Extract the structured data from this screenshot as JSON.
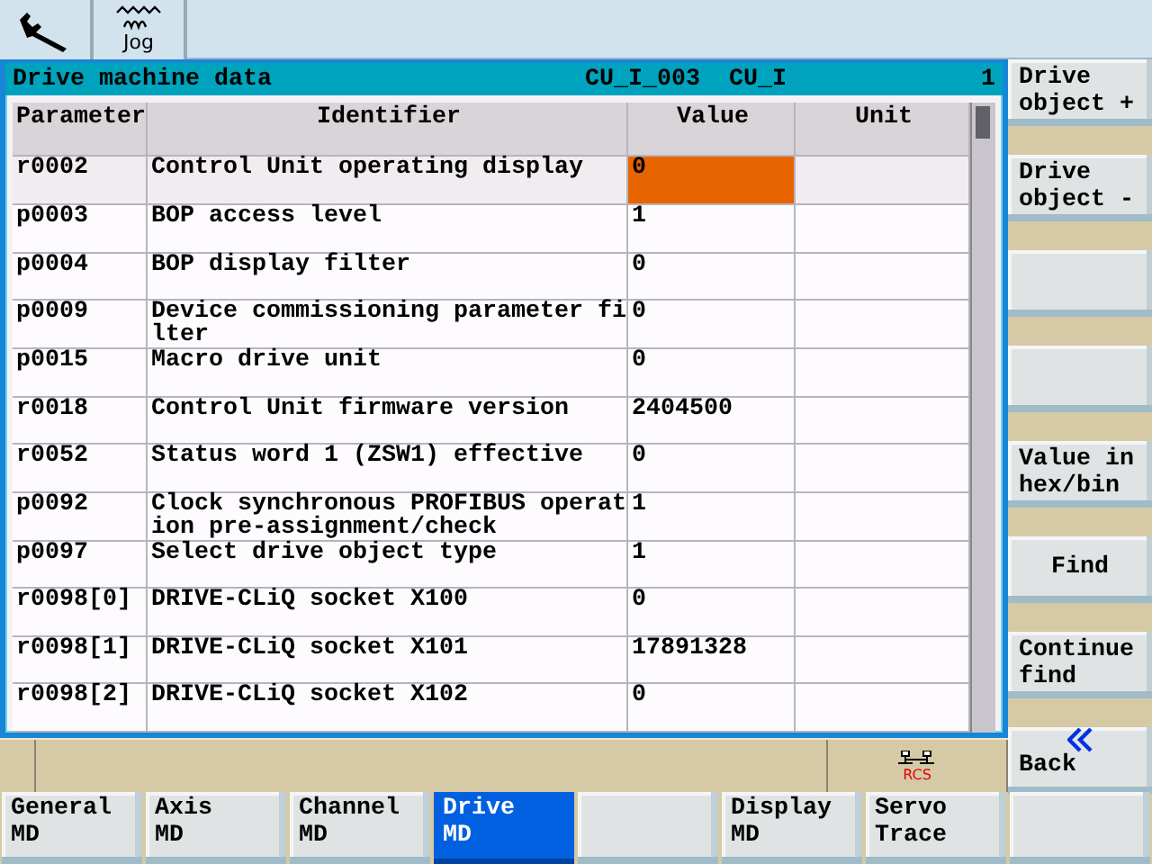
{
  "top_bar": {
    "jog_label": "Jog"
  },
  "window": {
    "title": "Drive machine data",
    "object_id": "CU_I_003",
    "object_type": "CU_I",
    "number": "1"
  },
  "table": {
    "columns": [
      "Parameter",
      "Identifier",
      "Value",
      "Unit"
    ],
    "rows": [
      {
        "parameter": "r0002",
        "identifier": "Control Unit operating display",
        "value": "0",
        "selected": true
      },
      {
        "parameter": "p0003",
        "identifier": "BOP access level",
        "value": "1",
        "selected": false
      },
      {
        "parameter": "p0004",
        "identifier": "BOP display filter",
        "value": "0",
        "selected": false
      },
      {
        "parameter": "p0009",
        "identifier": "Device commissioning parameter filter",
        "value": "0",
        "selected": false
      },
      {
        "parameter": "p0015",
        "identifier": "Macro drive unit",
        "value": "0",
        "selected": false
      },
      {
        "parameter": "r0018",
        "identifier": "Control Unit firmware version",
        "value": "2404500",
        "selected": false
      },
      {
        "parameter": "r0052",
        "identifier": "Status word 1 (ZSW1) effective",
        "value": "0",
        "selected": false
      },
      {
        "parameter": "p0092",
        "identifier": "Clock synchronous PROFIBUS operation pre-assignment/check",
        "value": "1",
        "selected": false
      },
      {
        "parameter": "p0097",
        "identifier": "Select drive object type",
        "value": "1",
        "selected": false
      },
      {
        "parameter": "r0098[0]",
        "identifier": "DRIVE-CLiQ socket X100",
        "value": "0",
        "selected": false
      },
      {
        "parameter": "r0098[1]",
        "identifier": "DRIVE-CLiQ socket X101",
        "value": "17891328",
        "selected": false
      },
      {
        "parameter": "r0098[2]",
        "identifier": "DRIVE-CLiQ socket X102",
        "value": "0",
        "selected": false
      }
    ]
  },
  "status_bar": {
    "network_label": "RCS"
  },
  "vertical_softkeys": [
    {
      "kind": "plain",
      "label": "Drive object +",
      "centered": false
    },
    {
      "kind": "plain",
      "label": "Drive object -",
      "centered": false
    },
    {
      "kind": "blank"
    },
    {
      "kind": "blank"
    },
    {
      "kind": "plain",
      "label": "Value in hex/bin",
      "centered": false
    },
    {
      "kind": "plain",
      "label": "Find",
      "centered": true
    },
    {
      "kind": "plain",
      "label": "Continue find",
      "centered": false
    },
    {
      "kind": "back",
      "label": "Back"
    }
  ],
  "horizontal_softkeys": [
    {
      "label": "General MD",
      "selected": false
    },
    {
      "label": "Axis MD",
      "selected": false
    },
    {
      "label": "Channel MD",
      "selected": false
    },
    {
      "label": "Drive MD",
      "selected": true
    },
    {
      "selected": false
    },
    {
      "label": "Display MD",
      "selected": false
    },
    {
      "label": "Servo Trace",
      "selected": false
    },
    {
      "selected": false
    }
  ]
}
